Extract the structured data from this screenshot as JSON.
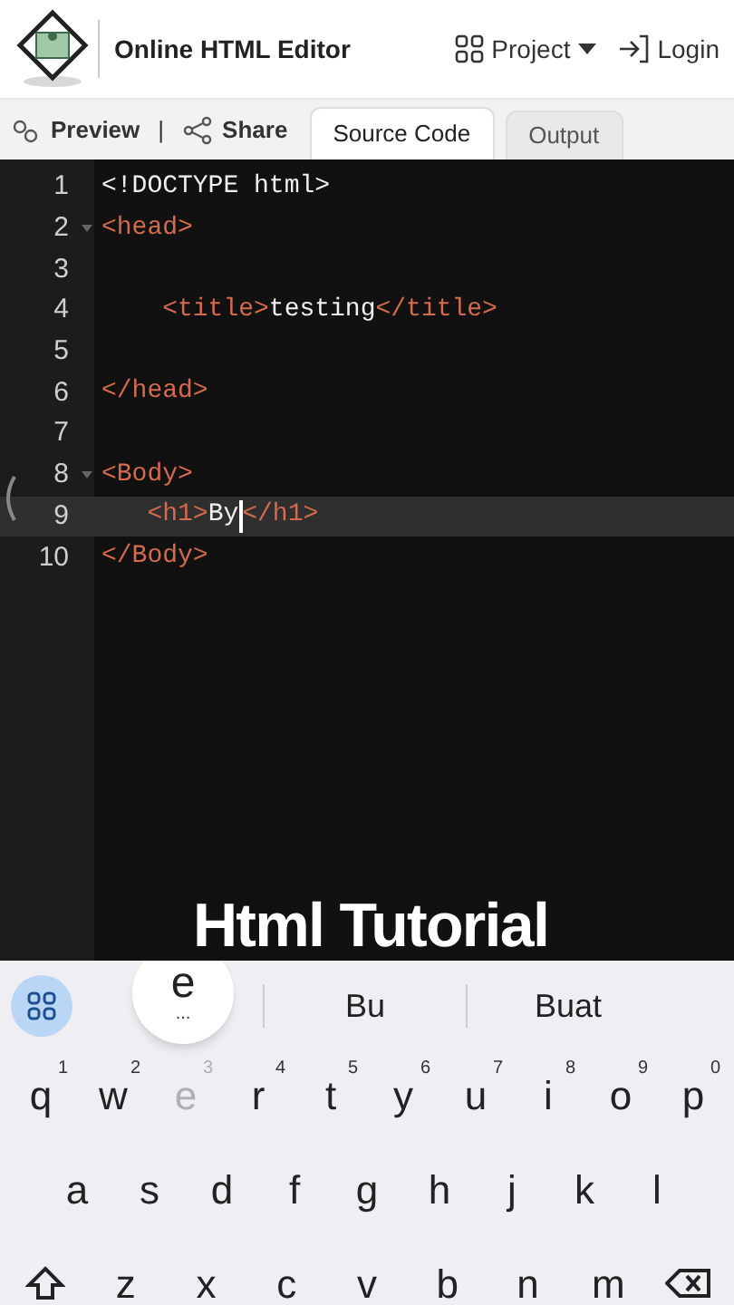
{
  "header": {
    "title": "Online HTML Editor",
    "project_label": "Project",
    "login_label": "Login"
  },
  "toolbar": {
    "preview_label": "Preview",
    "separator": "|",
    "share_label": "Share"
  },
  "tabs": [
    {
      "label": "Source Code",
      "selected": true
    },
    {
      "label": "Output",
      "selected": false
    }
  ],
  "editor": {
    "lines": [
      {
        "number": "1",
        "foldable": false,
        "current": false,
        "segments": [
          {
            "text": "<!DOCTYPE html>",
            "kind": "plain"
          }
        ]
      },
      {
        "number": "2",
        "foldable": true,
        "current": false,
        "segments": [
          {
            "text": "<head>",
            "kind": "tag"
          }
        ]
      },
      {
        "number": "3",
        "foldable": false,
        "current": false
      },
      {
        "number": "4",
        "foldable": false,
        "current": false,
        "segments": [
          {
            "text": "    <title>",
            "kind": "tag"
          },
          {
            "text": "testing",
            "kind": "plain"
          },
          {
            "text": "</title>",
            "kind": "tag"
          }
        ]
      },
      {
        "number": "5",
        "foldable": false,
        "current": false
      },
      {
        "number": "6",
        "foldable": false,
        "current": false,
        "segments": [
          {
            "text": "</head>",
            "kind": "tag"
          }
        ]
      },
      {
        "number": "7",
        "foldable": false,
        "current": false
      },
      {
        "number": "8",
        "foldable": true,
        "current": false,
        "segments": [
          {
            "text": "<Body>",
            "kind": "tag"
          }
        ]
      },
      {
        "number": "9",
        "foldable": false,
        "current": true,
        "segments": [
          {
            "text": "   <h1>",
            "kind": "tag"
          },
          {
            "text": "By",
            "kind": "plain"
          },
          {
            "kind": "cursor"
          },
          {
            "text": "</h1>",
            "kind": "tag"
          }
        ]
      },
      {
        "number": "10",
        "foldable": false,
        "current": false,
        "segments": [
          {
            "text": "</Body>",
            "kind": "tag"
          }
        ]
      }
    ]
  },
  "caption": "Html Tutorial",
  "keyboard": {
    "key_preview": "e",
    "key_preview_more": "...",
    "suggestions": [
      "Bu",
      "Buat"
    ],
    "rows": [
      [
        {
          "kind": "letter",
          "label": "q",
          "hint": "1",
          "pressed": false
        },
        {
          "kind": "letter",
          "label": "w",
          "hint": "2",
          "pressed": false
        },
        {
          "kind": "letter",
          "label": "e",
          "hint": "3",
          "pressed": true
        },
        {
          "kind": "letter",
          "label": "r",
          "hint": "4",
          "pressed": false
        },
        {
          "kind": "letter",
          "label": "t",
          "hint": "5",
          "pressed": false
        },
        {
          "kind": "letter",
          "label": "y",
          "hint": "6",
          "pressed": false
        },
        {
          "kind": "letter",
          "label": "u",
          "hint": "7",
          "pressed": false
        },
        {
          "kind": "letter",
          "label": "i",
          "hint": "8",
          "pressed": false
        },
        {
          "kind": "letter",
          "label": "o",
          "hint": "9",
          "pressed": false
        },
        {
          "kind": "letter",
          "label": "p",
          "hint": "0",
          "pressed": false
        }
      ],
      [
        {
          "kind": "letter",
          "label": "a",
          "pressed": false
        },
        {
          "kind": "letter",
          "label": "s",
          "pressed": false
        },
        {
          "kind": "letter",
          "label": "d",
          "pressed": false
        },
        {
          "kind": "letter",
          "label": "f",
          "pressed": false
        },
        {
          "kind": "letter",
          "label": "g",
          "pressed": false
        },
        {
          "kind": "letter",
          "label": "h",
          "pressed": false
        },
        {
          "kind": "letter",
          "label": "j",
          "pressed": false
        },
        {
          "kind": "letter",
          "label": "k",
          "pressed": false
        },
        {
          "kind": "letter",
          "label": "l",
          "pressed": false
        }
      ],
      [
        {
          "kind": "shift"
        },
        {
          "kind": "letter",
          "label": "z",
          "pressed": false
        },
        {
          "kind": "letter",
          "label": "x",
          "pressed": false
        },
        {
          "kind": "letter",
          "label": "c",
          "pressed": false
        },
        {
          "kind": "letter",
          "label": "v",
          "pressed": false
        },
        {
          "kind": "letter",
          "label": "b",
          "pressed": false
        },
        {
          "kind": "letter",
          "label": "n",
          "pressed": false
        },
        {
          "kind": "letter",
          "label": "m",
          "pressed": false
        },
        {
          "kind": "backspace"
        }
      ]
    ]
  }
}
